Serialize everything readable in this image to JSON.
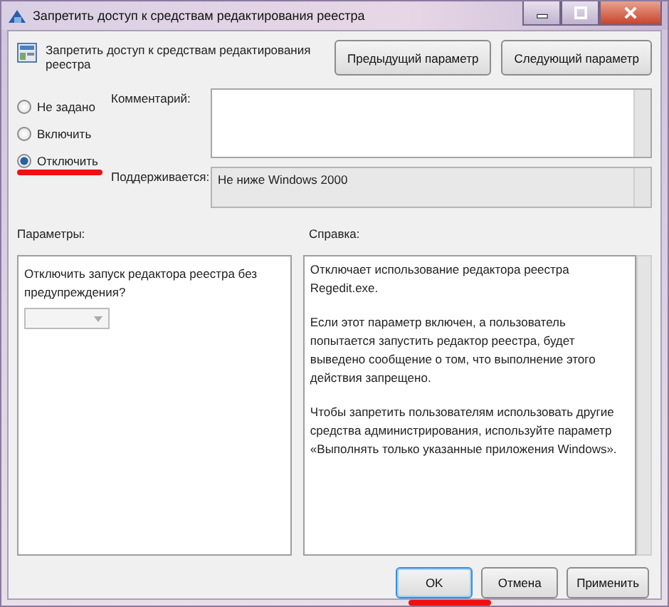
{
  "window": {
    "title": "Запретить доступ к средствам редактирования реестра"
  },
  "header": {
    "title": "Запретить доступ к средствам редактирования реестра",
    "buttons": [
      "Предыдущий параметр",
      "Следующий параметр"
    ]
  },
  "options": [
    {
      "label": "Не задано",
      "selected": false
    },
    {
      "label": "Включить",
      "selected": false
    },
    {
      "label": "Отключить",
      "selected": true
    }
  ],
  "comment": {
    "label": "Комментарий:"
  },
  "supported": {
    "label": "Поддерживается:",
    "value": "Не ниже Windows 2000"
  },
  "parameters": {
    "label": "Параметры:",
    "question": "Отключить запуск редактора реестра без предупреждения?",
    "dropdown_disabled": true
  },
  "help": {
    "label": "Справка:",
    "paragraphs": [
      "Отключает использование редактора реестра Regedit.exe.",
      "Если этот параметр включен, а пользователь попытается запустить редактор реестра, будет выведено сообщение о том, что выполнение этого действия запрещено.",
      "Чтобы запретить пользователям использовать другие средства администрирования, используйте параметр «Выполнять только указанные приложения Windows»."
    ]
  },
  "buttons": [
    {
      "label": "OK",
      "focused": true
    },
    {
      "label": "Отмена",
      "focused": false
    },
    {
      "label": "Применить",
      "focused": false
    }
  ]
}
